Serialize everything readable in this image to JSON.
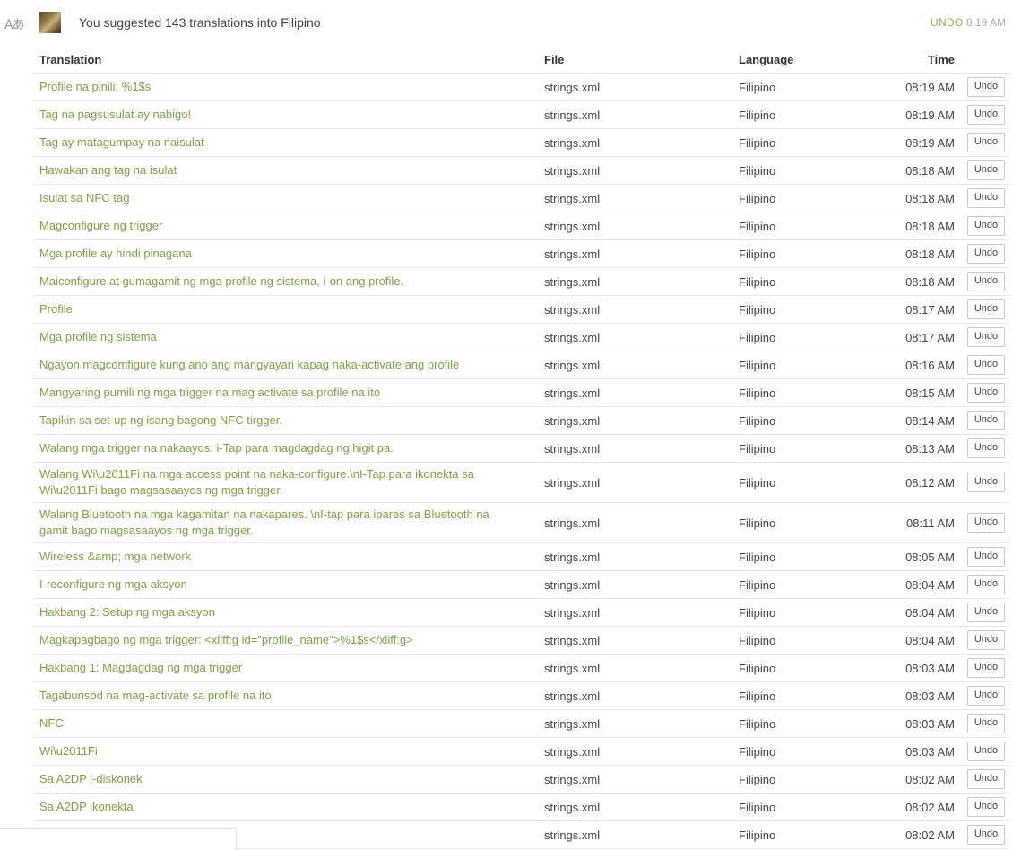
{
  "header": {
    "icon": "translate-icon",
    "icon_glyph": "Aあ",
    "summary": "You suggested 143 translations into Filipino",
    "undo_label": "UNDO",
    "time": "8:19 AM"
  },
  "columns": {
    "translation": "Translation",
    "file": "File",
    "language": "Language",
    "time": "Time"
  },
  "rows": [
    {
      "translation": "Profile na pinili: %1$s",
      "file": "strings.xml",
      "language": "Filipino",
      "time": "08:19 AM",
      "action": "Undo"
    },
    {
      "translation": "Tag na pagsusulat ay nabigo!",
      "file": "strings.xml",
      "language": "Filipino",
      "time": "08:19 AM",
      "action": "Undo"
    },
    {
      "translation": "Tag ay matagumpay na naisulat",
      "file": "strings.xml",
      "language": "Filipino",
      "time": "08:19 AM",
      "action": "Undo"
    },
    {
      "translation": "Hawakan ang tag na isulat",
      "file": "strings.xml",
      "language": "Filipino",
      "time": "08:18 AM",
      "action": "Undo"
    },
    {
      "translation": "Isulat sa NFC tag",
      "file": "strings.xml",
      "language": "Filipino",
      "time": "08:18 AM",
      "action": "Undo"
    },
    {
      "translation": "Magconfigure ng trigger",
      "file": "strings.xml",
      "language": "Filipino",
      "time": "08:18 AM",
      "action": "Undo"
    },
    {
      "translation": "Mga profile ay hindi pinagana",
      "file": "strings.xml",
      "language": "Filipino",
      "time": "08:18 AM",
      "action": "Undo"
    },
    {
      "translation": "Maiconfigure at gumagamit ng mga profile ng sistema, i-on ang profile.",
      "file": "strings.xml",
      "language": "Filipino",
      "time": "08:18 AM",
      "action": "Undo"
    },
    {
      "translation": "Profile",
      "file": "strings.xml",
      "language": "Filipino",
      "time": "08:17 AM",
      "action": "Undo"
    },
    {
      "translation": "Mga profile ng sistema",
      "file": "strings.xml",
      "language": "Filipino",
      "time": "08:17 AM",
      "action": "Undo"
    },
    {
      "translation": "Ngayon magcomfigure kung ano ang mangyayari kapag naka-activate ang profile",
      "file": "strings.xml",
      "language": "Filipino",
      "time": "08:16 AM",
      "action": "Undo"
    },
    {
      "translation": "Mangyaring pumili ng mga trigger na mag activate sa profile na ito",
      "file": "strings.xml",
      "language": "Filipino",
      "time": "08:15 AM",
      "action": "Undo"
    },
    {
      "translation": "Tapikin sa set-up ng isang bagong NFC tirgger.",
      "file": "strings.xml",
      "language": "Filipino",
      "time": "08:14 AM",
      "action": "Undo"
    },
    {
      "translation": "Walang mga trigger na nakaayos. i-Tap para magdagdag ng higit pa.",
      "file": "strings.xml",
      "language": "Filipino",
      "time": "08:13 AM",
      "action": "Undo"
    },
    {
      "translation": "Walang Wi\\u2011Fi na mga access point na naka-configure.\\nI-Tap para ikonekta sa Wi\\u2011Fi bago magsasaayos ng mga trigger.",
      "file": "strings.xml",
      "language": "Filipino",
      "time": "08:12 AM",
      "action": "Undo",
      "tall": true
    },
    {
      "translation": "Walang Bluetooth na mga kagamitan na nakapares. \\nI-tap para ipares sa Bluetooth na gamit bago magsasaayos ng mga trigger.",
      "file": "strings.xml",
      "language": "Filipino",
      "time": "08:11 AM",
      "action": "Undo",
      "tall": true
    },
    {
      "translation": "Wireless &amp; mga network",
      "file": "strings.xml",
      "language": "Filipino",
      "time": "08:05 AM",
      "action": "Undo"
    },
    {
      "translation": "I-reconfigure ng mga aksyon",
      "file": "strings.xml",
      "language": "Filipino",
      "time": "08:04 AM",
      "action": "Undo"
    },
    {
      "translation": "Hakbang 2: Setup ng mga aksyon",
      "file": "strings.xml",
      "language": "Filipino",
      "time": "08:04 AM",
      "action": "Undo"
    },
    {
      "translation": "Magkapagbago ng mga trigger: <xliff:g id=\"profile_name\">%1$s</xliff:g>",
      "file": "strings.xml",
      "language": "Filipino",
      "time": "08:04 AM",
      "action": "Undo"
    },
    {
      "translation": "Hakbang 1: Magdagdag ng mga trigger",
      "file": "strings.xml",
      "language": "Filipino",
      "time": "08:03 AM",
      "action": "Undo"
    },
    {
      "translation": "Tagabunsod na mag-activate sa profile na ito",
      "file": "strings.xml",
      "language": "Filipino",
      "time": "08:03 AM",
      "action": "Undo"
    },
    {
      "translation": "NFC",
      "file": "strings.xml",
      "language": "Filipino",
      "time": "08:03 AM",
      "action": "Undo"
    },
    {
      "translation": "Wi\\u2011Fi",
      "file": "strings.xml",
      "language": "Filipino",
      "time": "08:03 AM",
      "action": "Undo"
    },
    {
      "translation": "Sa A2DP i-diskonek",
      "file": "strings.xml",
      "language": "Filipino",
      "time": "08:02 AM",
      "action": "Undo"
    },
    {
      "translation": "Sa A2DP ikonekta",
      "file": "strings.xml",
      "language": "Filipino",
      "time": "08:02 AM",
      "action": "Undo"
    },
    {
      "translation": "",
      "file": "strings.xml",
      "language": "Filipino",
      "time": "08:02 AM",
      "action": "Undo"
    }
  ]
}
